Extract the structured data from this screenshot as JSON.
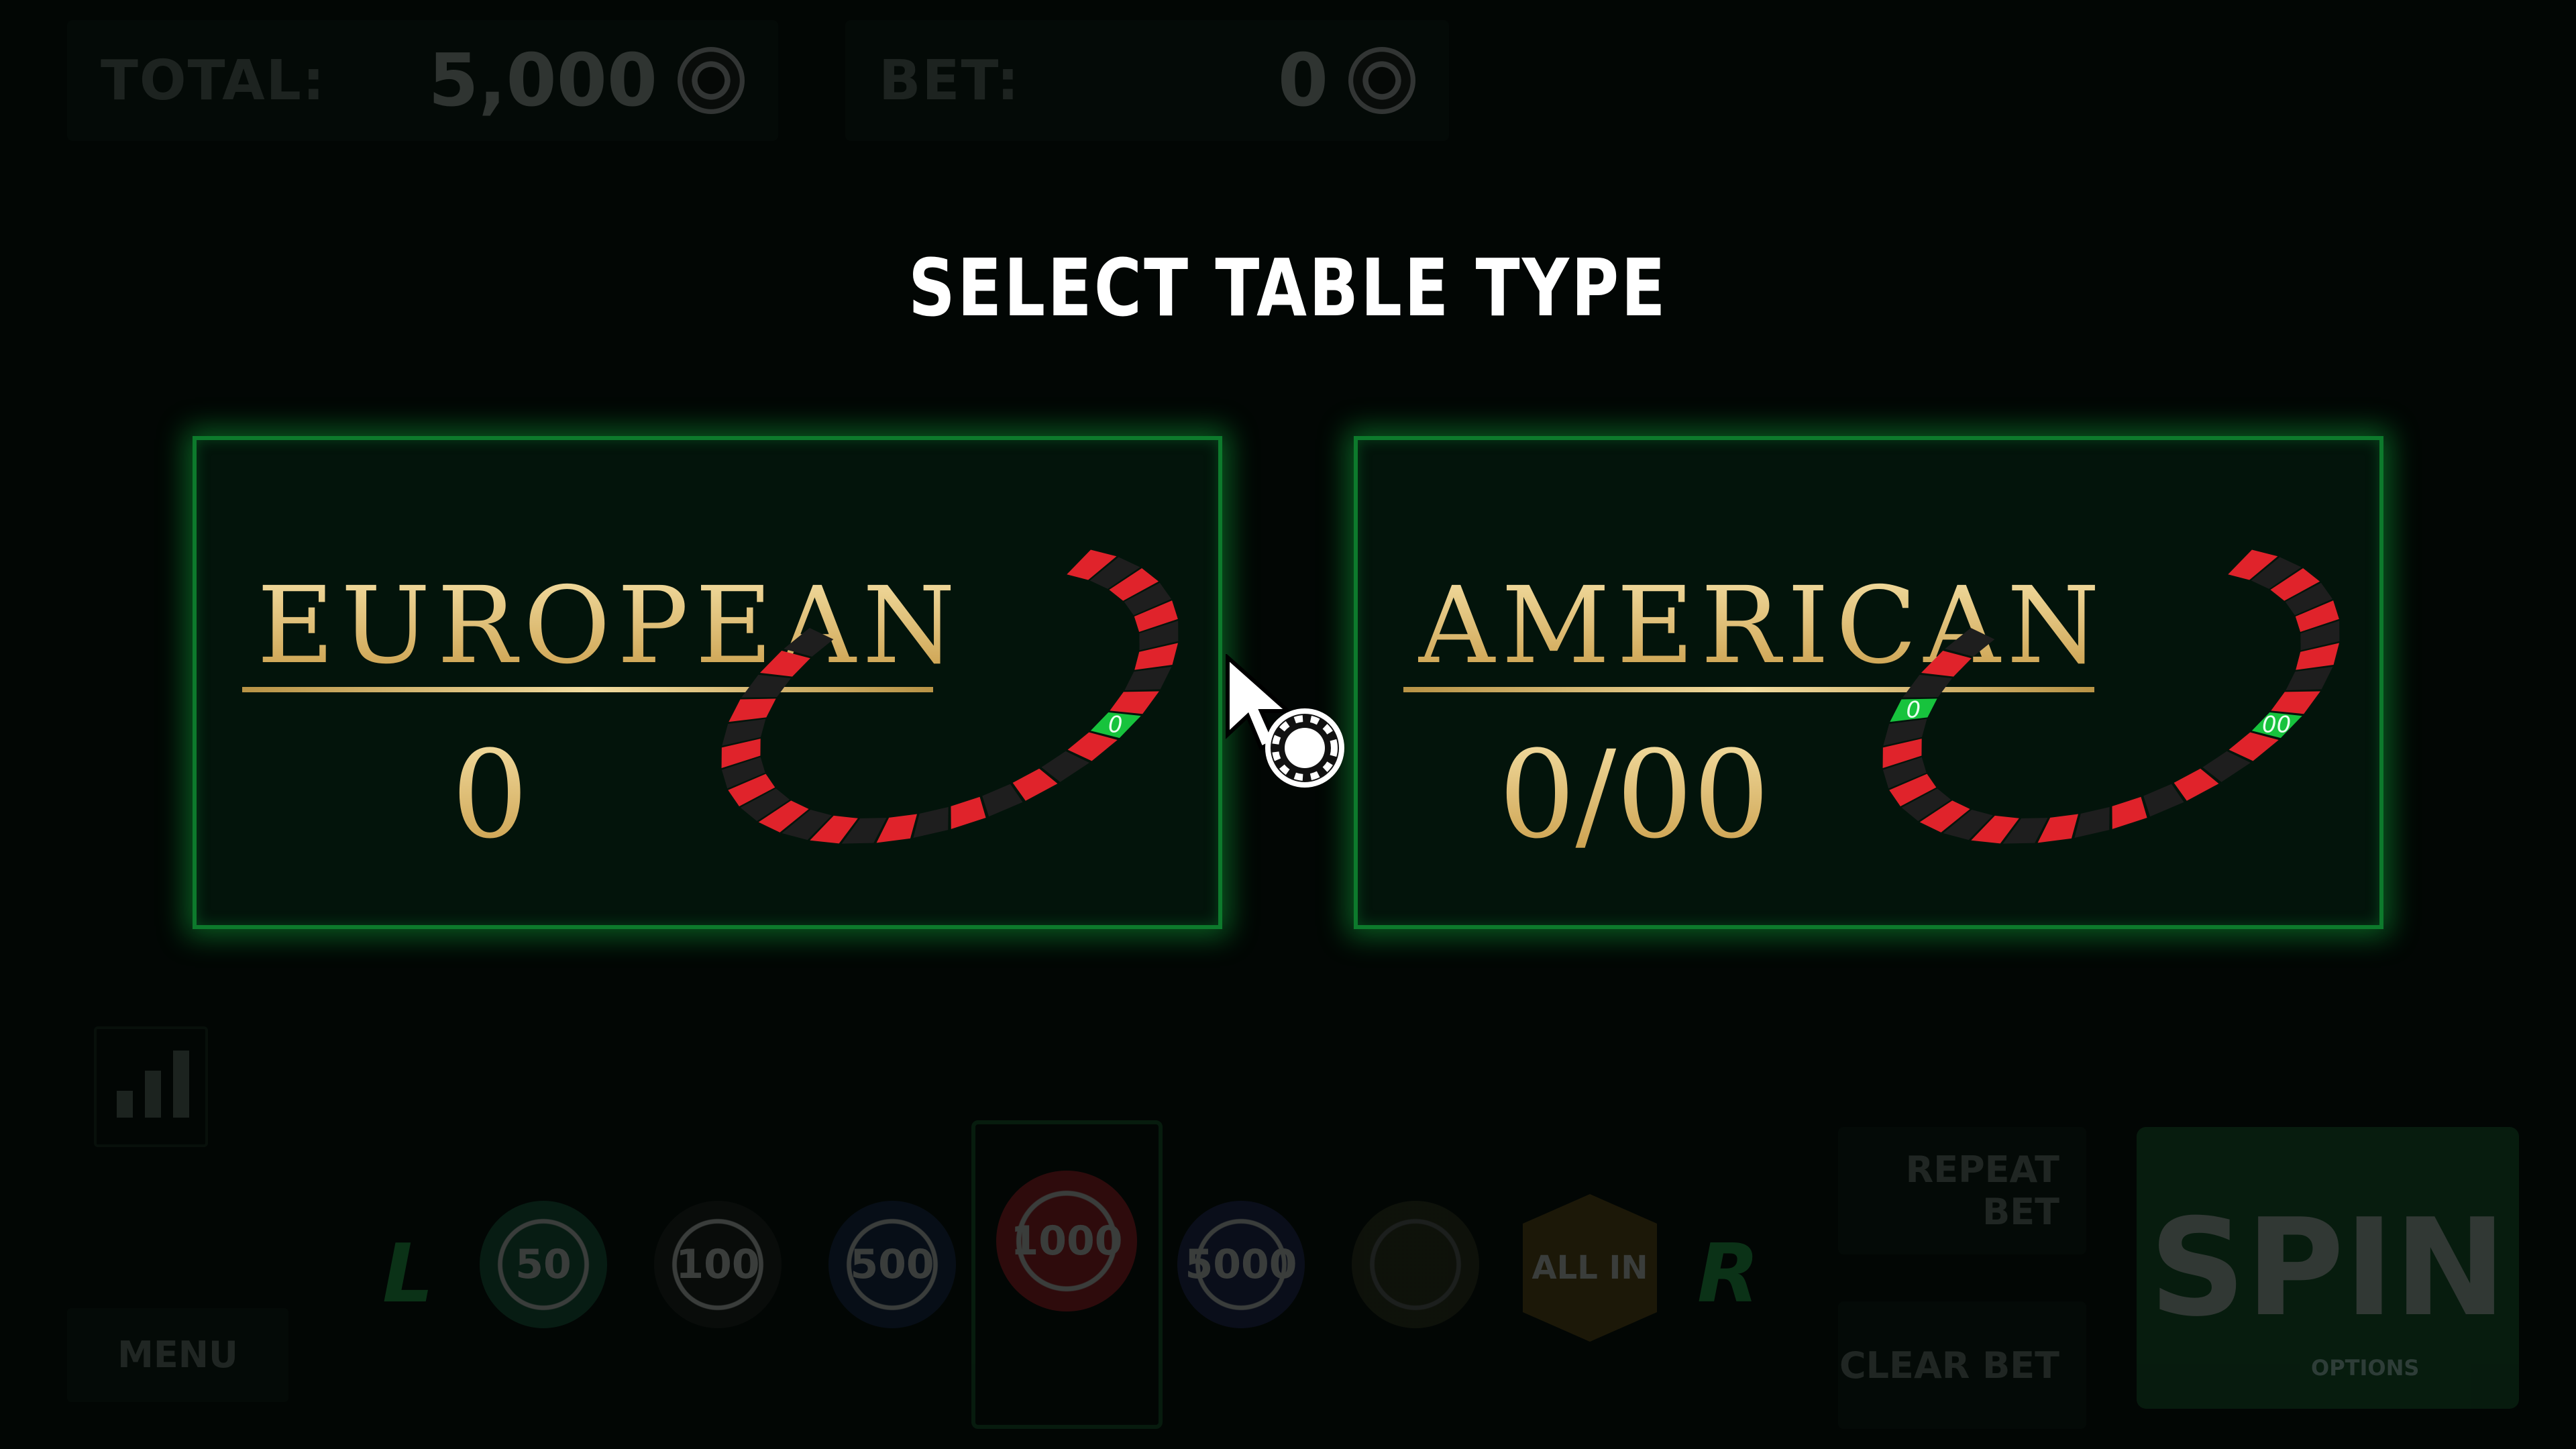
{
  "header": {
    "total_label": "TOTAL:",
    "total_value": "5,000",
    "bet_label": "BET:",
    "bet_value": "0"
  },
  "dialog": {
    "title": "SELECT TABLE TYPE",
    "options": [
      {
        "name": "EUROPEAN",
        "zeros": "0",
        "wheel_zero_labels": [
          "0"
        ]
      },
      {
        "name": "AMERICAN",
        "zeros": "0/00",
        "wheel_zero_labels": [
          "00",
          "0"
        ]
      }
    ]
  },
  "bottom": {
    "menu_label": "MENU",
    "left_arrow": "L",
    "right_arrow": "R",
    "chips": [
      "50",
      "100",
      "500",
      "1000",
      "5000"
    ],
    "selected_chip": "1000",
    "all_in_label": "ALL IN",
    "repeat_bet_label": "REPEAT BET",
    "clear_bet_label": "CLEAR BET",
    "spin_label": "SPIN",
    "options_label": "OPTIONS"
  },
  "colors": {
    "panel_glow": "#14c846",
    "gold": "#e9cf8c",
    "wheel_red": "#e0232b",
    "wheel_black": "#1e1e1e",
    "wheel_green": "#17c33d"
  }
}
